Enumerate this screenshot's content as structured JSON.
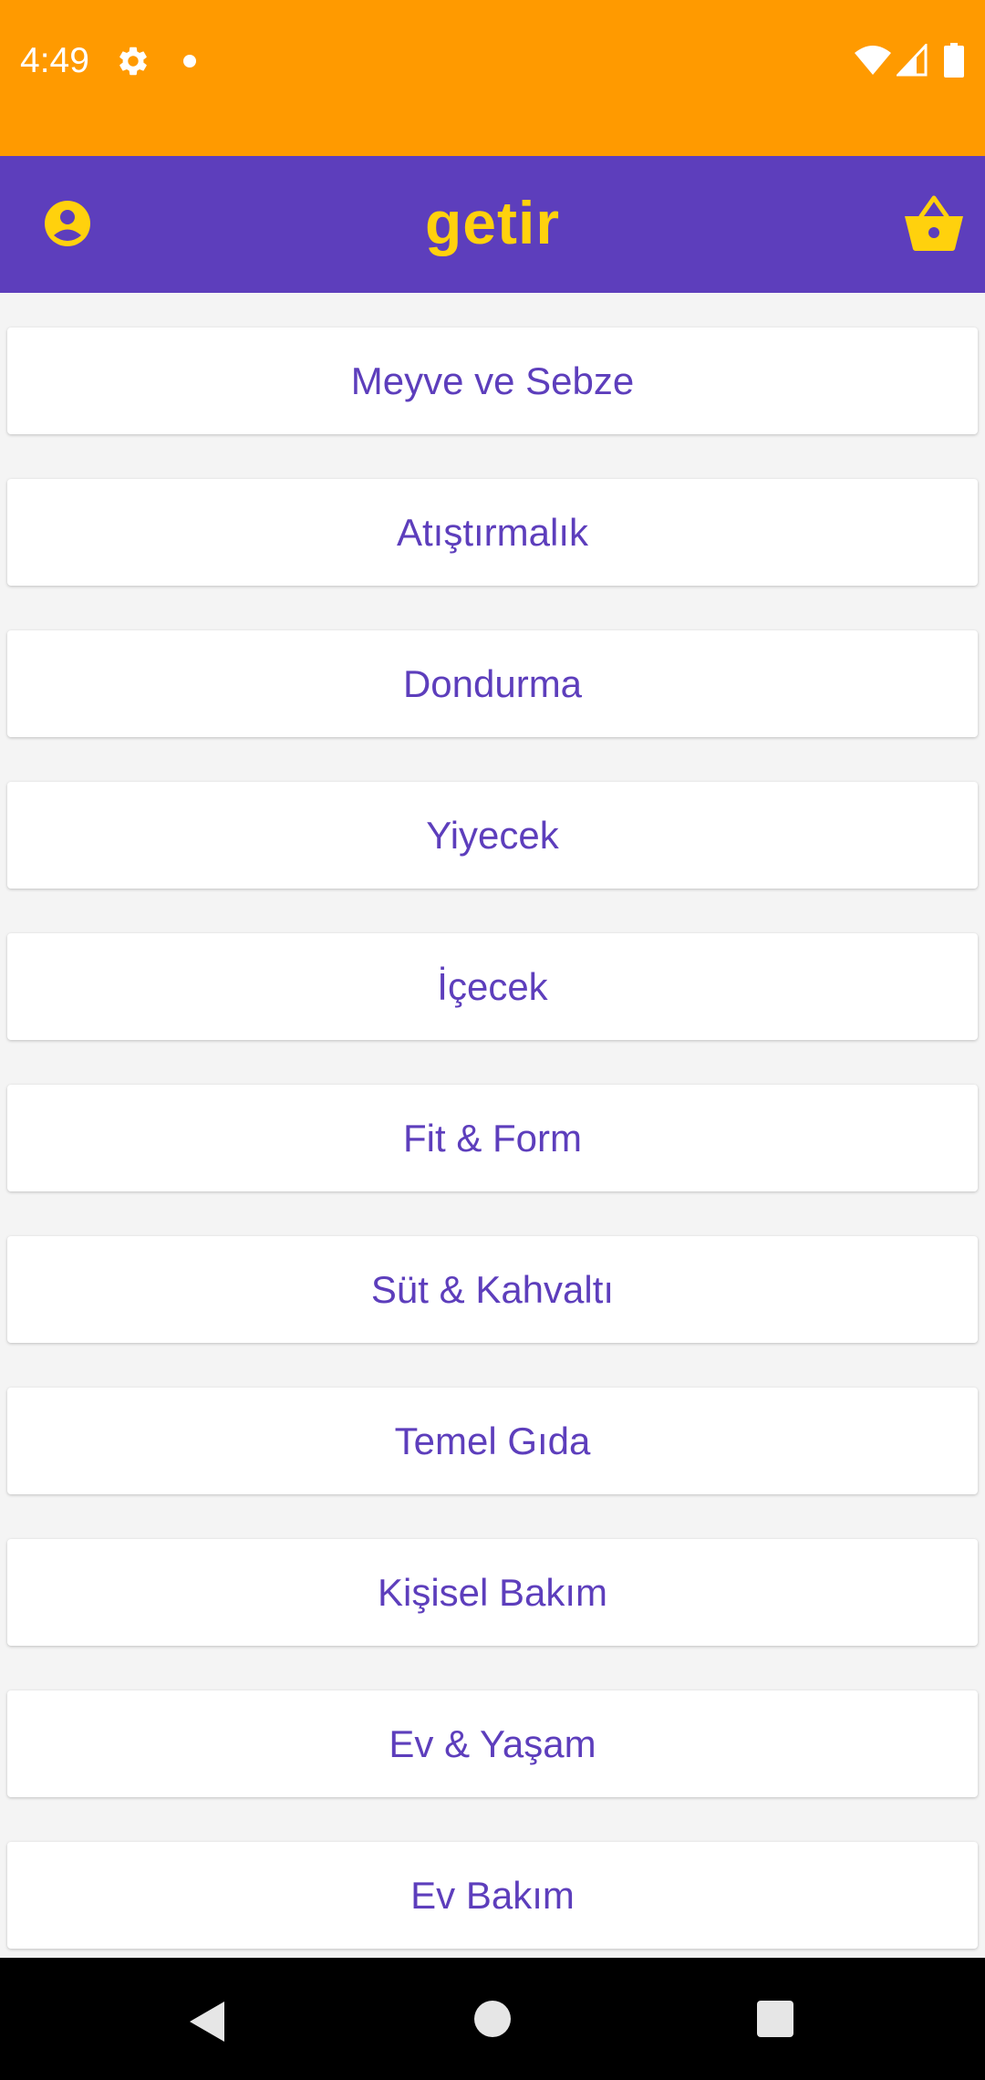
{
  "status_bar": {
    "time": "4:49",
    "icons": [
      "gear-icon",
      "notification-dot-icon",
      "wifi-icon",
      "signal-icon",
      "battery-icon"
    ]
  },
  "app_bar": {
    "logo": "getir",
    "profile_icon": "account-circle-icon",
    "basket_icon": "basket-icon"
  },
  "categories": [
    "Meyve ve Sebze",
    "Atıştırmalık",
    "Dondurma",
    "Yiyecek",
    "İçecek",
    "Fit & Form",
    "Süt & Kahvaltı",
    "Temel Gıda",
    "Kişisel Bakım",
    "Ev & Yaşam",
    "Ev Bakım"
  ],
  "nav_bar": {
    "icons": [
      "back-icon",
      "home-icon",
      "recents-icon"
    ]
  },
  "colors": {
    "status_bar": "#FF9A00",
    "app_bar": "#5D3EBC",
    "accent_yellow": "#FFD10D",
    "category_text": "#5D3EBC",
    "background": "#F4F4F4"
  }
}
